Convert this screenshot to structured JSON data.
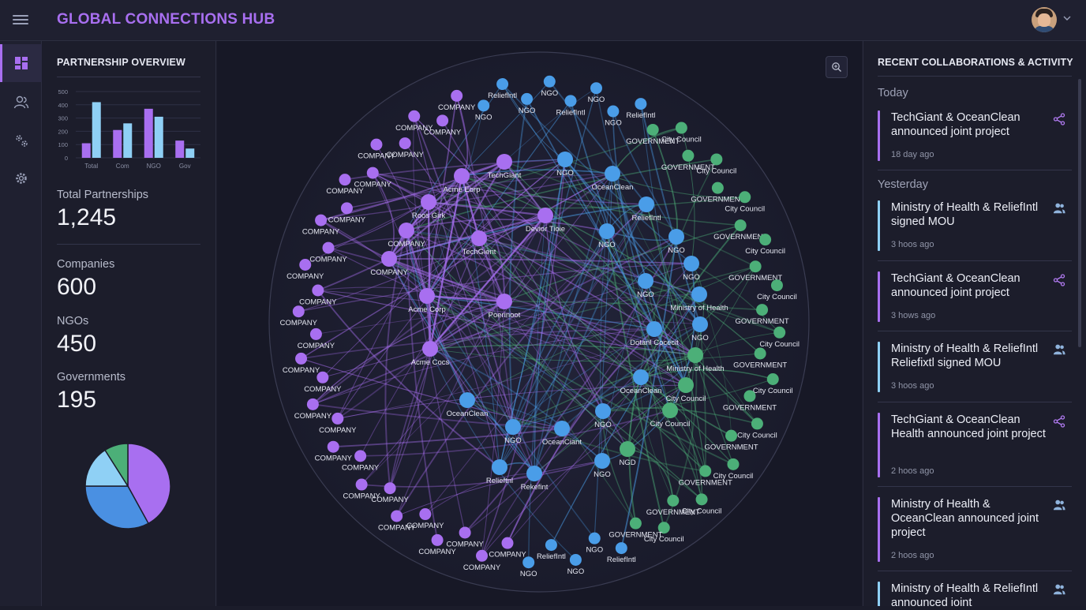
{
  "app": {
    "title": "GLOBAL CONNECTIONS HUB"
  },
  "nav": {
    "items": [
      "dashboard-icon",
      "users-icon",
      "gears-icon",
      "settings-icon"
    ],
    "active": 0
  },
  "overview": {
    "heading": "PARTNERSHIP OVERVIEW",
    "total_label": "Total Partnerships",
    "total_value": "1,245",
    "companies_label": "Companies",
    "companies_value": "600",
    "ngos_label": "NGOs",
    "ngos_value": "450",
    "gov_label": "Governments",
    "gov_value": "195"
  },
  "chart_data": [
    {
      "type": "bar",
      "categories": [
        "Total",
        "Com",
        "NGO",
        "Gov"
      ],
      "series": [
        {
          "values": [
            110,
            420
          ],
          "color": "#a86ff0"
        },
        {
          "values": [
            210,
            260
          ],
          "color": "#8fd0f5"
        }
      ],
      "grouped_values": [
        [
          110,
          420
        ],
        [
          210,
          260
        ],
        [
          370,
          310
        ],
        [
          130,
          70
        ]
      ],
      "yticks": [
        "500",
        "400",
        "300",
        "200",
        "100",
        "0"
      ],
      "ylim": [
        0,
        500
      ],
      "colors": [
        "#a86ff0",
        "#8fd0f5"
      ]
    },
    {
      "type": "pie",
      "values": [
        42,
        33,
        16,
        9
      ],
      "colors": [
        "#a86ff0",
        "#4a90e2",
        "#8fd0f5",
        "#4caf78"
      ]
    }
  ],
  "network": {
    "colors": {
      "company": "#a86ff0",
      "ngo": "#4a9de8",
      "gov": "#4caf78"
    },
    "labels_company": [
      "COMPANY",
      "Acme Eorp",
      "TechGiant",
      "Roos Girk",
      "Devior Tioie",
      "TechGient",
      "Acme Corp",
      "Poerinoot",
      "Acme Cocs"
    ],
    "labels_ngo": [
      "NGO",
      "ReliefIntl",
      "OceanClean",
      "Ministry of Health",
      "Dotanl Cocecit",
      "OceanClean",
      "OceanCiant",
      "Relieftnl",
      "Rekefint",
      "Hailaablanl",
      "Rahcfint"
    ],
    "labels_gov": [
      "GOVERNMENT",
      "City Council",
      "Ministry of Health",
      "Rattenkrnl",
      "NGD"
    ]
  },
  "activity": {
    "heading": "RECENT COLLABORATIONS & ACTIVITY",
    "day_today": "Today",
    "day_yesterday": "Yesterday",
    "items": [
      {
        "title": "TechGiant & OceanClean announced joint project",
        "time": "18 day ago",
        "icon": "share-icon",
        "color": "#a86ff0"
      },
      {
        "title": "Ministry of Health & ReliefIntl signed MOU",
        "time": "3 hoos ago",
        "icon": "users-icon",
        "color": "#8fd0f5"
      },
      {
        "title": "TechGiant & OceanClean announced joint project",
        "time": "3 hows ago",
        "icon": "share-icon",
        "color": "#a86ff0"
      },
      {
        "title": "Ministry of Health & ReliefIntl Reliefixtl signed MOU",
        "time": "3 hoos ago",
        "icon": "users-icon",
        "color": "#8fd0f5"
      },
      {
        "title": "TechGiant & OceanClean Health announced joint project",
        "time": "2 hoos ago",
        "icon": "share-icon",
        "color": "#a86ff0"
      },
      {
        "title": "Ministry of Health & OceanClean announced joint project",
        "time": "2 hoos ago",
        "icon": "users-icon",
        "color": "#a86ff0"
      },
      {
        "title": "Ministry of Health & ReliefIntl announced joint",
        "time": "",
        "icon": "users-icon",
        "color": "#8fd0f5"
      }
    ]
  }
}
